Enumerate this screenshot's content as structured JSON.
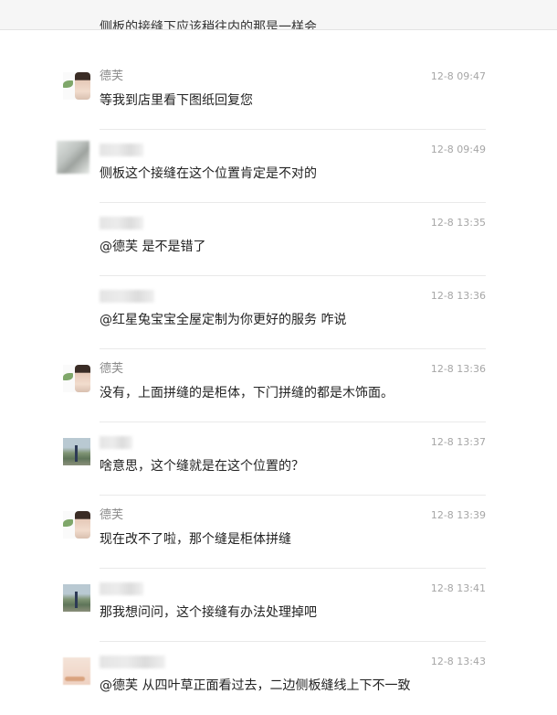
{
  "top_partial_text": "侧板的接缝下应该稍往内的那是一样会",
  "messages": [
    {
      "avatar": "defu",
      "sender": "德芙",
      "time": "12-8 09:47",
      "text": "等我到店里看下图纸回复您"
    },
    {
      "avatar": "blur-gray",
      "sender": "",
      "time": "12-8 09:49",
      "text": "侧板这个接缝在这个位置肯定是不对的"
    },
    {
      "avatar": "blank",
      "sender": "",
      "time": "12-8 13:35",
      "text": "@德芙 是不是错了"
    },
    {
      "avatar": "blank",
      "sender": "",
      "time": "12-8 13:36",
      "text": "@红星兔宝宝全屋定制为你更好的服务 咋说"
    },
    {
      "avatar": "defu",
      "sender": "德芙",
      "time": "12-8 13:36",
      "text": "没有，上面拼缝的是柜体，下门拼缝的都是木饰面。"
    },
    {
      "avatar": "land",
      "sender": "",
      "time": "12-8 13:37",
      "text": "啥意思，这个缝就是在这个位置的？"
    },
    {
      "avatar": "defu",
      "sender": "德芙",
      "time": "12-8 13:39",
      "text": "现在改不了啦，那个缝是柜体拼缝"
    },
    {
      "avatar": "land",
      "sender": "",
      "time": "12-8 13:41",
      "text": "那我想问问，这个接缝有办法处理掉吧"
    },
    {
      "avatar": "peach",
      "sender": "",
      "time": "12-8 13:43",
      "text": "@德芙 从四叶草正面看过去，二边侧板缝线上下不一致"
    }
  ]
}
